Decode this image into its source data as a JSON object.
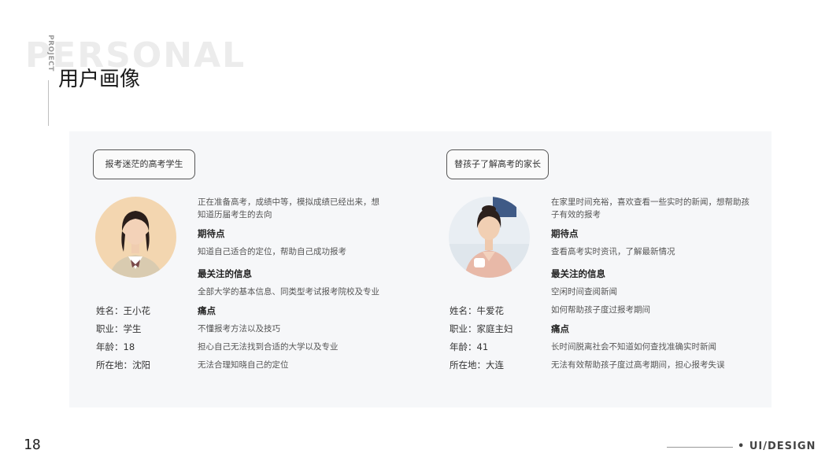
{
  "header": {
    "bg_word": "PERSONAL",
    "vertical_label": "PROJECT",
    "title": "用户画像"
  },
  "personas": [
    {
      "tag": "报考迷茫的高考学生",
      "name": "姓名：王小花",
      "job": "职业：学生",
      "age": "年龄：18",
      "location": "所在地：沈阳",
      "intro": "正在准备高考，成绩中等，模拟成绩已经出来，想知道历届考生的去向",
      "expect_head": "期待点",
      "expect_text": "知道自己适合的定位，帮助自己成功报考",
      "focus_head": "最关注的信息",
      "focus_text": "全部大学的基本信息、同类型考试报考院校及专业",
      "pain_head": "痛点",
      "pain_items": [
        "不懂报考方法以及技巧",
        "担心自己无法找到合适的大学以及专业",
        "无法合理知晓自己的定位"
      ]
    },
    {
      "tag": "替孩子了解高考的家长",
      "name": "姓名：牛爱花",
      "job": "职业：家庭主妇",
      "age": "年龄：41",
      "location": "所在地：大连",
      "intro": "在家里时间充裕，喜欢查看一些实时的新闻，想帮助孩子有效的报考",
      "expect_head": "期待点",
      "expect_text": "查看高考实时资讯，了解最新情况",
      "focus_head": "最关注的信息",
      "focus_items": [
        "空闲时间查阅新闻",
        "如何帮助孩子度过报考期间"
      ],
      "pain_head": "痛点",
      "pain_items": [
        "长时间脱离社会不知道如何查找准确实时新闻",
        "无法有效帮助孩子度过高考期间，担心报考失误"
      ]
    }
  ],
  "footer": {
    "page_number": "18",
    "brand": "• UI/DESIGN"
  }
}
